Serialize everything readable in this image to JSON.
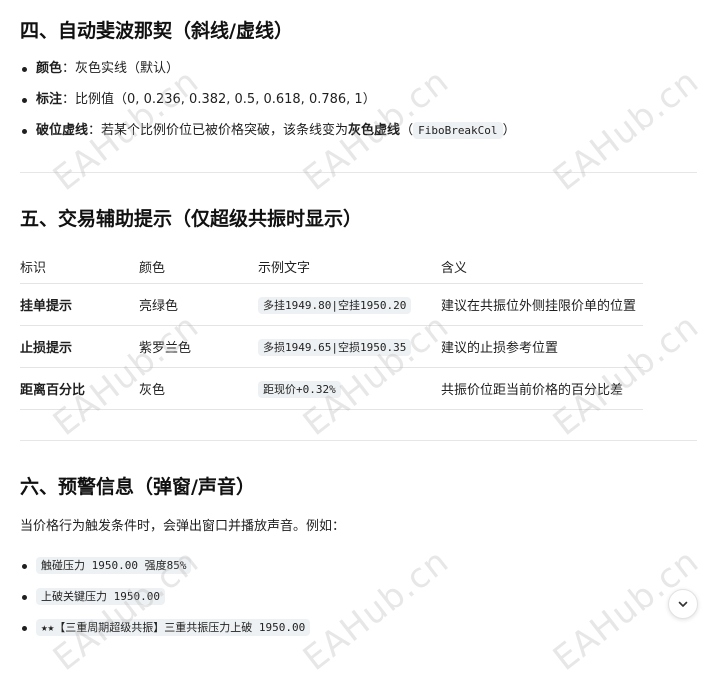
{
  "section4": {
    "title": "四、自动斐波那契（斜线/虚线）",
    "items": [
      {
        "label": "颜色",
        "sep": "：",
        "text": "灰色实线（默认）"
      },
      {
        "label": "标注",
        "sep": "：",
        "text": "比例值（0, 0.236, 0.382, 0.5, 0.618, 0.786, 1）"
      },
      {
        "label": "破位虚线",
        "sep": "：",
        "text": "若某个比例价位已被价格突破，该条线变为",
        "bold_after": "灰色虚线",
        "paren_open": "（",
        "code": "FiboBreakCol",
        "paren_close": "）"
      }
    ]
  },
  "section5": {
    "title": "五、交易辅助提示（仅超级共振时显示）",
    "table": {
      "headers": [
        "标识",
        "颜色",
        "示例文字",
        "含义"
      ],
      "rows": [
        {
          "id": "挂单提示",
          "color": "亮绿色",
          "example": "多挂1949.80|空挂1950.20",
          "meaning": "建议在共振位外侧挂限价单的位置"
        },
        {
          "id": "止损提示",
          "color": "紫罗兰色",
          "example": "多损1949.65|空损1950.35",
          "meaning": "建议的止损参考位置"
        },
        {
          "id": "距离百分比",
          "color": "灰色",
          "example": "距现价+0.32%",
          "meaning": "共振价位距当前价格的百分比差"
        }
      ]
    }
  },
  "section6": {
    "title": "六、预警信息（弹窗/声音）",
    "paragraph": "当价格行为触发条件时，会弹出窗口并播放声音。例如：",
    "items": [
      "触碰压力 1950.00 强度85%",
      "上破关键压力 1950.00",
      "★★【三重周期超级共振】三重共振压力上破 1950.00"
    ]
  },
  "watermark": "EAHub.cn",
  "icons": {
    "scroll_down": "chevron-down-icon"
  }
}
